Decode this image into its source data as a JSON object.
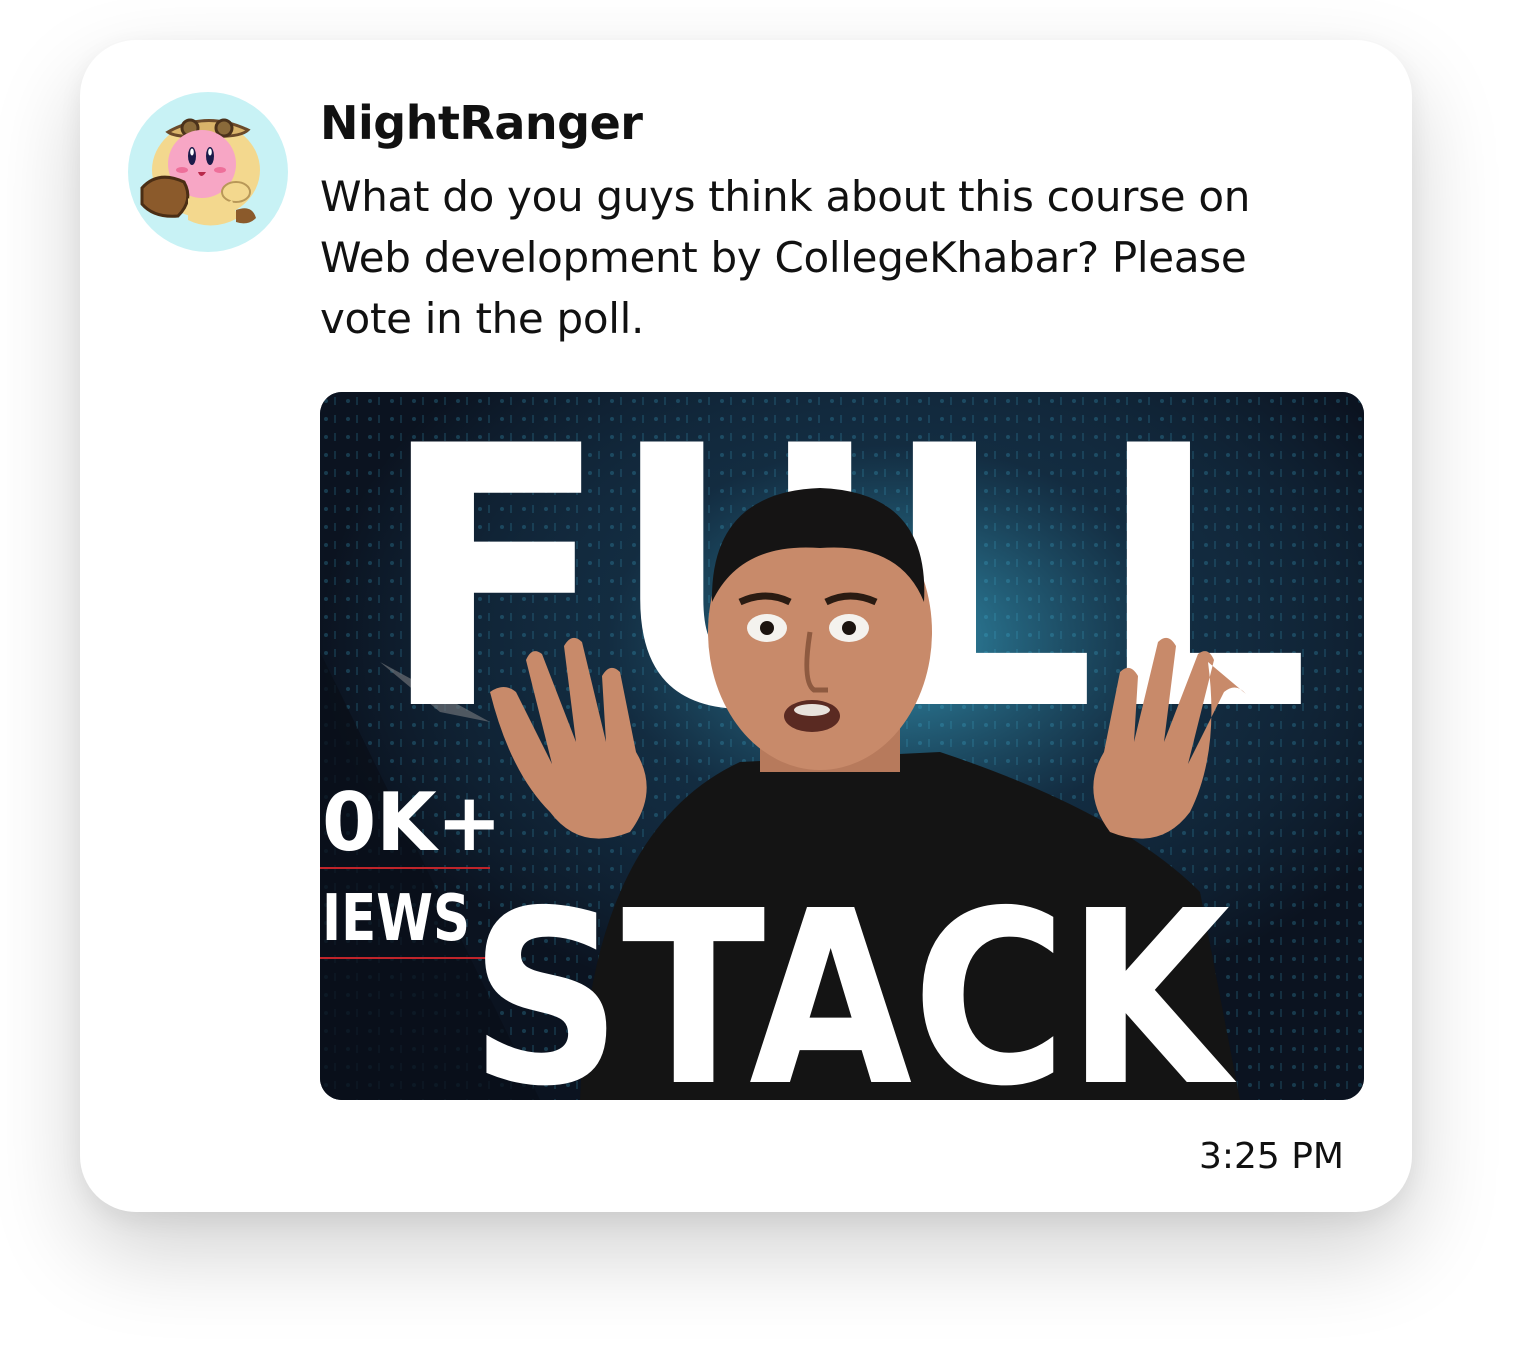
{
  "post": {
    "author": "NightRanger",
    "message": "What do you guys think about this course on Web development by CollegeKhabar? Please vote in the poll.",
    "timestamp": "3:25 PM",
    "thumbnail": {
      "headline_top": "FULL",
      "headline_bottom": "STACK",
      "side_count": "0K+",
      "side_label": "IEWS"
    }
  },
  "colors": {
    "card_background": "#ffffff",
    "avatar_background": "#c8f2f5",
    "text": "#111111",
    "thumbnail_background": "#0e1722",
    "accent_red": "#c0242a"
  },
  "icons": {
    "avatar": "kirby-avatar-icon"
  }
}
